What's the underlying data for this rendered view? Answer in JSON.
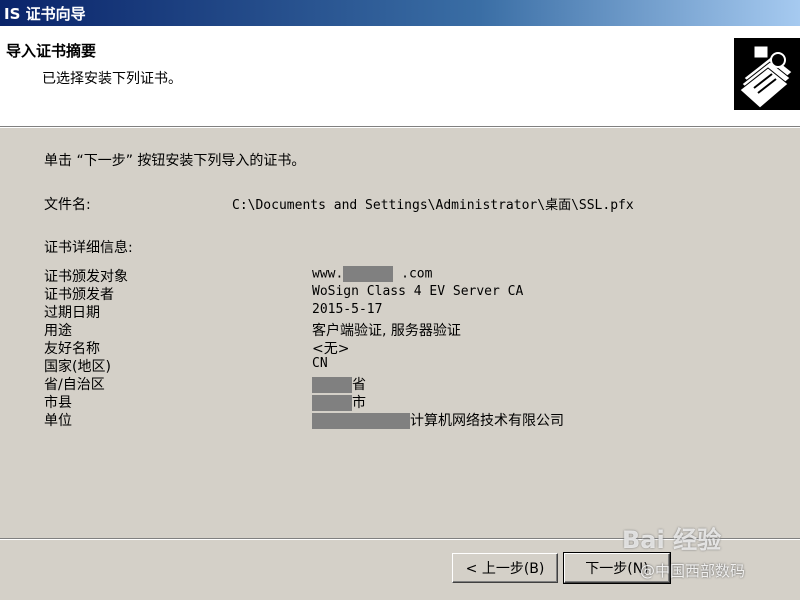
{
  "window": {
    "title": "IS 证书向导"
  },
  "header": {
    "title": "导入证书摘要",
    "subtitle": "已选择安装下列证书。",
    "icon": "certificate-icon"
  },
  "content": {
    "intro": "单击 “下一步” 按钮安装下列导入的证书。",
    "file_label": "文件名:",
    "file_value": "C:\\Documents and Settings\\Administrator\\桌面\\SSL.pfx",
    "details_label": "证书详细信息:",
    "details": [
      {
        "label": "证书颁发对象",
        "prefix": "www.",
        "suffix": ".com"
      },
      {
        "label": "证书颁发者",
        "value": "WoSign Class 4 EV Server CA"
      },
      {
        "label": "过期日期",
        "value": "2015-5-17"
      },
      {
        "label": "用途",
        "value": "客户端验证, 服务器验证"
      },
      {
        "label": "友好名称",
        "value": "<无>"
      },
      {
        "label": "国家(地区)",
        "value": "CN"
      },
      {
        "label": "省/自治区",
        "suffix": "省"
      },
      {
        "label": "市县",
        "suffix": "市"
      },
      {
        "label": "单位",
        "suffix": "计算机网络技术有限公司"
      }
    ]
  },
  "buttons": {
    "back": "< 上一步(B)",
    "next": "下一步(N)"
  },
  "watermark": {
    "logo": "Bai 经验",
    "credit": "@中国西部数码"
  }
}
